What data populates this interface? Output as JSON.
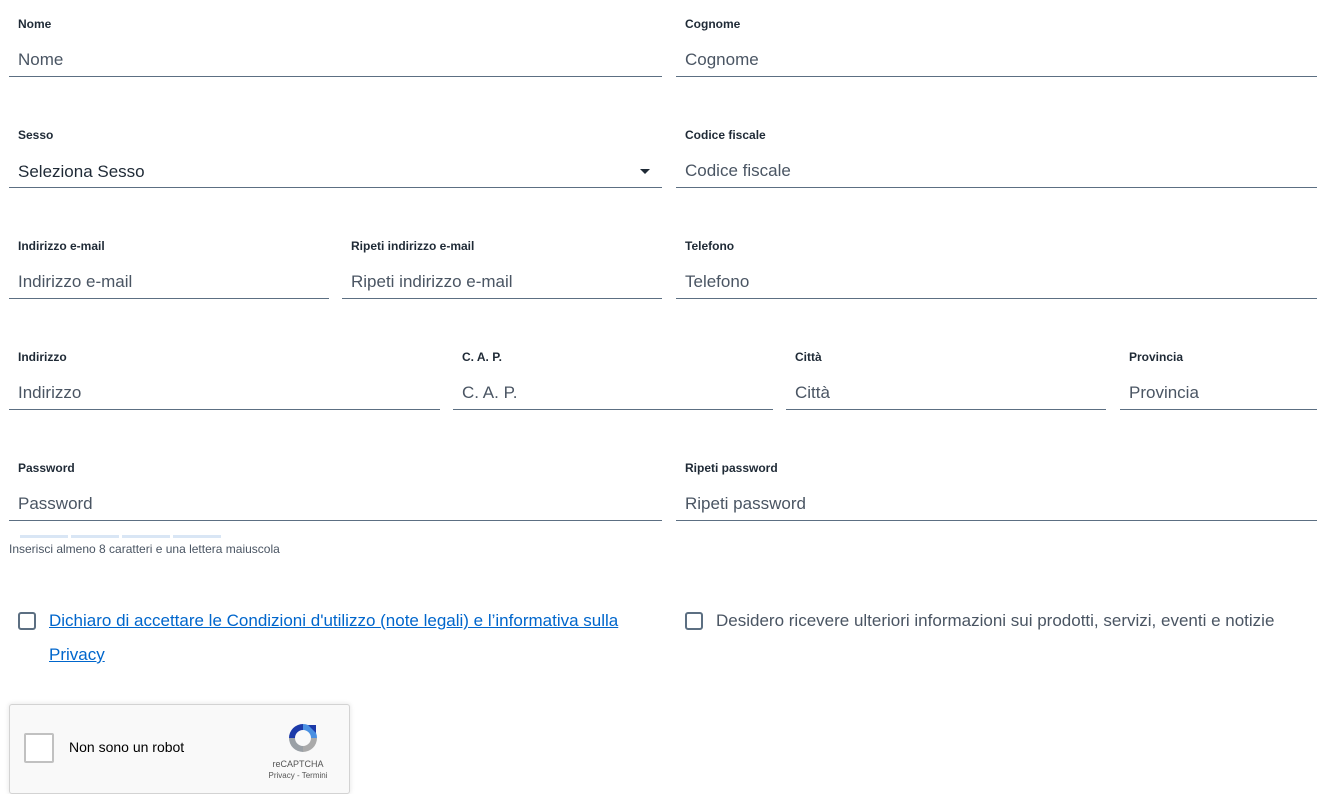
{
  "form": {
    "nome": {
      "label": "Nome",
      "placeholder": "Nome",
      "value": ""
    },
    "cognome": {
      "label": "Cognome",
      "placeholder": "Cognome",
      "value": ""
    },
    "sesso": {
      "label": "Sesso",
      "selected": "Seleziona Sesso"
    },
    "codice_fiscale": {
      "label": "Codice fiscale",
      "placeholder": "Codice fiscale",
      "value": ""
    },
    "email": {
      "label": "Indirizzo e-mail",
      "placeholder": "Indirizzo e-mail",
      "value": ""
    },
    "email_repeat": {
      "label": "Ripeti indirizzo e-mail",
      "placeholder": "Ripeti indirizzo e-mail",
      "value": ""
    },
    "telefono": {
      "label": "Telefono",
      "placeholder": "Telefono",
      "value": ""
    },
    "indirizzo": {
      "label": "Indirizzo",
      "placeholder": "Indirizzo",
      "value": ""
    },
    "cap": {
      "label": "C. A. P.",
      "placeholder": "C. A. P.",
      "value": ""
    },
    "citta": {
      "label": "Città",
      "placeholder": "Città",
      "value": ""
    },
    "provincia": {
      "label": "Provincia",
      "placeholder": "Provincia",
      "value": ""
    },
    "password": {
      "label": "Password",
      "placeholder": "Password",
      "value": ""
    },
    "password_repeat": {
      "label": "Ripeti password",
      "placeholder": "Ripeti password",
      "value": ""
    },
    "password_hint": "Inserisci almeno 8 caratteri e una lettera maiuscola",
    "password_strength": 0
  },
  "consents": {
    "privacy": {
      "checked": false,
      "text": "Dichiaro di accettare le Condizioni d'utilizzo (note legali) e l’informativa sulla Privacy"
    },
    "marketing": {
      "checked": false,
      "text": "Desidero ricevere ulteriori informazioni sui prodotti, servizi, eventi e notizie"
    }
  },
  "recaptcha": {
    "label": "Non sono un robot",
    "brand": "reCAPTCHA",
    "privacy_link": "Privacy",
    "separator": " - ",
    "terms_link": "Termini"
  },
  "colors": {
    "text": "#1f2a36",
    "field_border": "#5c6f82",
    "link": "#0066cc",
    "strength_bar": "#d9e6f5"
  }
}
